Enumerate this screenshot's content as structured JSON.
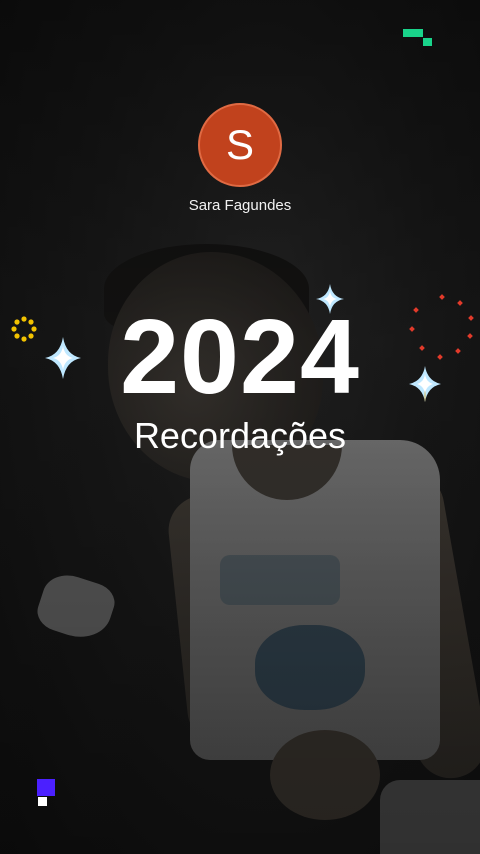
{
  "profile": {
    "avatar_letter": "S",
    "name": "Sara Fagundes"
  },
  "headline": {
    "year": "2024",
    "subtitle": "Recordações"
  },
  "decorations": {
    "sparkle_color": "#bfe8ff",
    "ring_yellow": "#f2c200",
    "ring_red": "#e23a2a",
    "logo_green": "#19d38a",
    "corner_purple": "#4b20ff"
  }
}
